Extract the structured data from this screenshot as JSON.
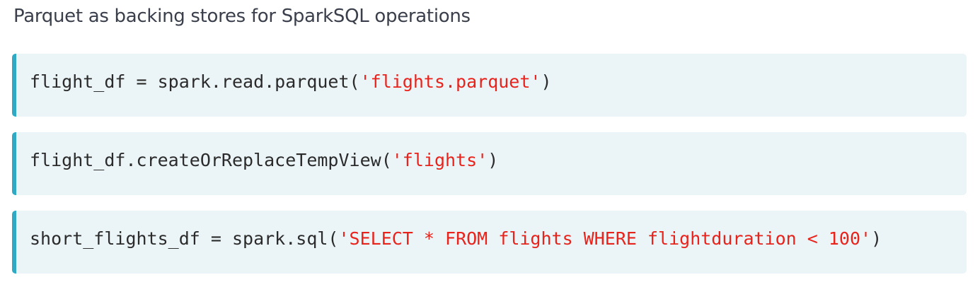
{
  "heading": "Parquet as backing stores for SparkSQL operations",
  "code_blocks": [
    {
      "prefix": "flight_df = spark.read.parquet(",
      "string": "'flights.parquet'",
      "suffix": ")"
    },
    {
      "prefix": "flight_df.createOrReplaceTempView(",
      "string": "'flights'",
      "suffix": ")"
    },
    {
      "prefix": "short_flights_df = spark.sql(",
      "string": "'SELECT * FROM flights WHERE flightduration < 100'",
      "suffix": ")"
    }
  ],
  "colors": {
    "string": "#e8231c",
    "code_text": "#2b2b2b",
    "block_background": "#ebf4f7",
    "block_accent": "#2fa9c4",
    "heading": "#3a3f4b"
  }
}
